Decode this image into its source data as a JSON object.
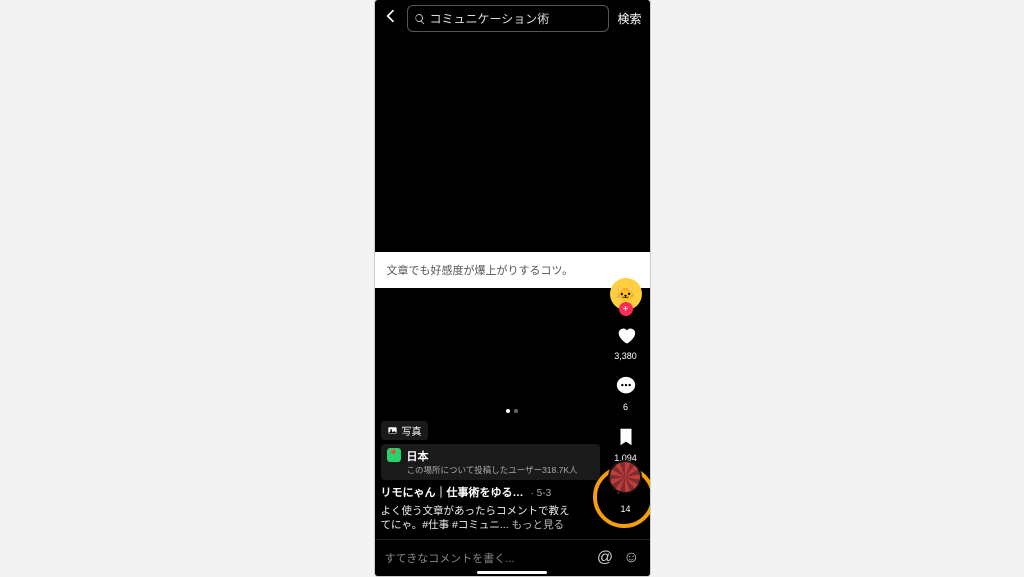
{
  "header": {
    "search_query": "コミュニケーション術",
    "search_button": "検索"
  },
  "post": {
    "caption_card": "文章でも好感度が爆上がりするコツ。",
    "photo_badge": "写真",
    "location": {
      "name": "日本",
      "subtitle": "この場所について投稿したユーザー318.7K人"
    },
    "creator": "リモにゃん｜仕事術をゆる…",
    "date": "· 5-3",
    "description_line1": "よく使う文章があったらコメントで教え",
    "description_line2": "てにゃ。#仕事 #コミュニ...",
    "see_more": "もっと見る"
  },
  "actions": {
    "like_count": "3,380",
    "comment_count": "6",
    "bookmark_count": "1,094",
    "share_count": "14"
  },
  "comment_bar": {
    "placeholder": "すてきなコメントを書く..."
  }
}
